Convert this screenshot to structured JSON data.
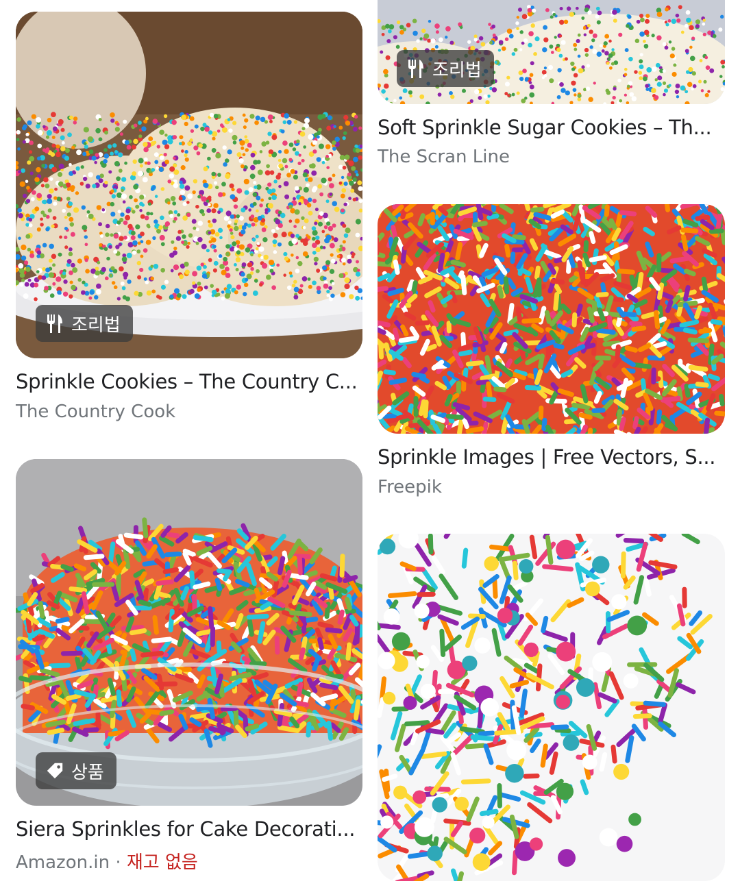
{
  "results": [
    {
      "title": "Sprinkle Cookies – The Country C...",
      "source": "The Country Cook",
      "badge": {
        "icon": "fork-knife-icon",
        "label": "조리법"
      }
    },
    {
      "title": "Soft Sprinkle Sugar Cookies – Th...",
      "source": "The Scran Line",
      "badge": {
        "icon": "fork-knife-icon",
        "label": "조리법"
      }
    },
    {
      "title": "Sprinkle Images | Free Vectors, S...",
      "source": "Freepik"
    },
    {
      "title": "Siera Sprinkles for Cake Decorati...",
      "source": "Amazon.in",
      "separator": "·",
      "stock_status": "재고 없음",
      "badge": {
        "icon": "price-tag-icon",
        "label": "상품"
      }
    },
    {
      "title": "",
      "source": ""
    }
  ],
  "colors": {
    "title": "#202124",
    "source": "#70757a",
    "out_of_stock": "#c5221f",
    "badge_bg": "rgba(60,60,60,0.78)"
  }
}
